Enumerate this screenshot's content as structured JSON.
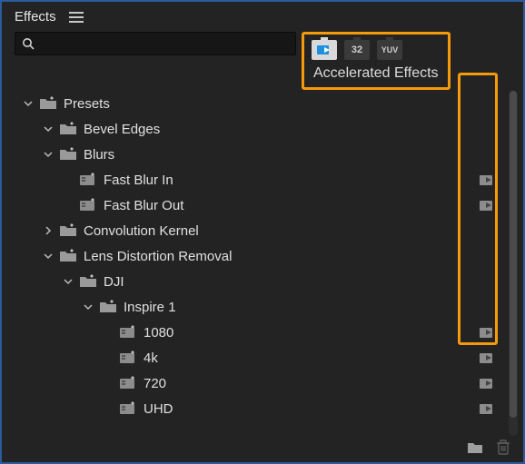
{
  "panel": {
    "title": "Effects"
  },
  "search": {
    "value": "",
    "placeholder": ""
  },
  "filterBadges": {
    "accelerated": {
      "active": true
    },
    "bit32": {
      "label": "32"
    },
    "yuv": {
      "label": "YUV"
    },
    "tooltip": "Accelerated Effects"
  },
  "tree": {
    "presets": {
      "label": "Presets",
      "bevel_edges": {
        "label": "Bevel Edges"
      },
      "blurs": {
        "label": "Blurs",
        "fast_blur_in": {
          "label": "Fast Blur In",
          "accelerated": true
        },
        "fast_blur_out": {
          "label": "Fast Blur Out",
          "accelerated": true
        }
      },
      "convolution_kernel": {
        "label": "Convolution Kernel"
      },
      "lens_distortion_removal": {
        "label": "Lens Distortion Removal",
        "dji": {
          "label": "DJI",
          "inspire1": {
            "label": "Inspire 1",
            "p1080": {
              "label": "1080",
              "accelerated": true
            },
            "p4k": {
              "label": "4k",
              "accelerated": true
            },
            "p720": {
              "label": "720",
              "accelerated": true
            },
            "puhd": {
              "label": "UHD",
              "accelerated": true
            }
          }
        }
      }
    }
  },
  "colors": {
    "highlight": "#f59a0b",
    "panel_border": "#2a5b9e",
    "accel_blue": "#1b8fe0"
  }
}
